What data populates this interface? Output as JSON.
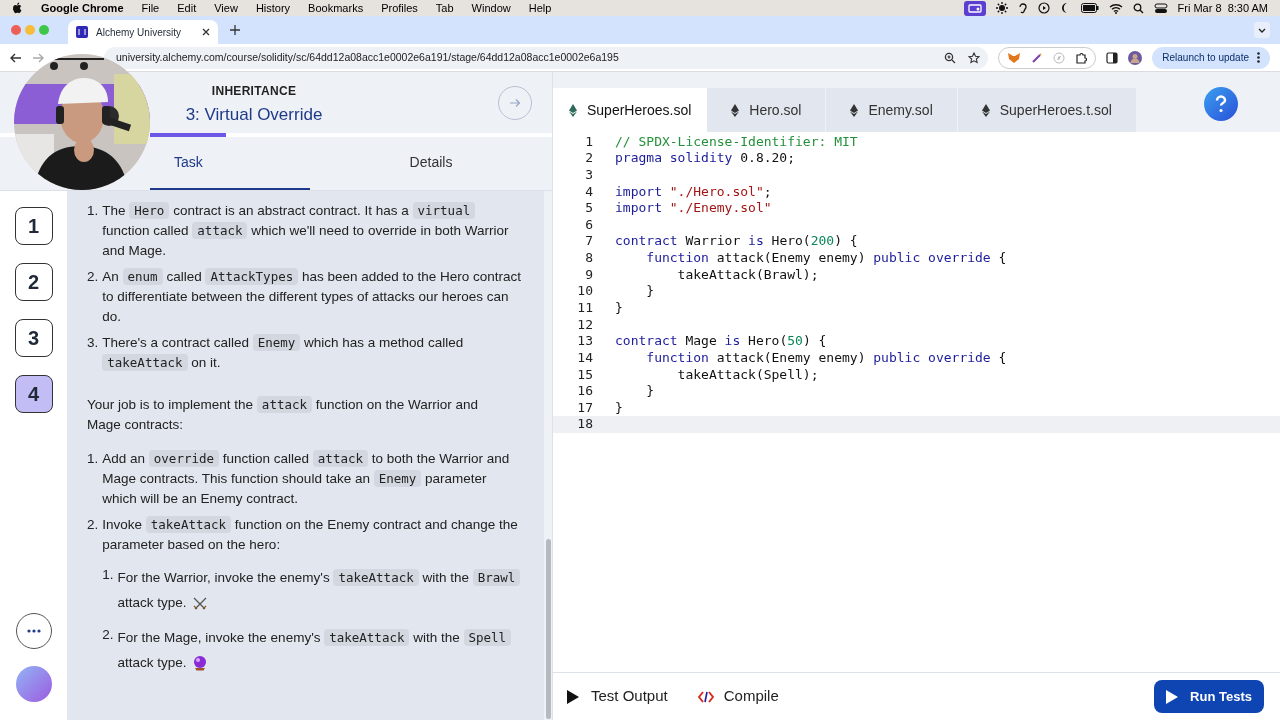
{
  "menubar": {
    "app": "Google Chrome",
    "menus": [
      "File",
      "Edit",
      "View",
      "History",
      "Bookmarks",
      "Profiles",
      "Tab",
      "Window",
      "Help"
    ],
    "clock": "Fri Mar 8  8:30 AM"
  },
  "browser": {
    "tab_title": "Alchemy University",
    "url": "university.alchemy.com/course/solidity/sc/64dd12a08acc1e0002e6a191/stage/64dd12a08acc1e0002e6a195",
    "relaunch": "Relaunch to update"
  },
  "lesson": {
    "section": "INHERITANCE",
    "title": "3: Virtual Override",
    "progress": {
      "level": 0.19
    },
    "tabs": [
      {
        "label": "Task",
        "selected": true
      },
      {
        "label": "Details",
        "selected": false
      }
    ]
  },
  "stages": [
    {
      "label": "1",
      "selected": false
    },
    {
      "label": "2",
      "selected": false
    },
    {
      "label": "3",
      "selected": false
    },
    {
      "label": "4",
      "selected": true
    }
  ],
  "task": [
    {
      "kind": "list",
      "items": [
        {
          "number": "1.",
          "parts": [
            {
              "kind": "text",
              "text": "The "
            },
            {
              "kind": "code",
              "text": "Hero"
            },
            {
              "kind": "text",
              "text": " contract is an abstract contract. It has a "
            },
            {
              "kind": "code",
              "text": "virtual"
            },
            {
              "kind": "text",
              "text": " function called "
            },
            {
              "kind": "code",
              "text": "attack"
            },
            {
              "kind": "text",
              "text": " which we'll need to override in both Warrior and Mage."
            }
          ]
        },
        {
          "number": "2.",
          "parts": [
            {
              "kind": "text",
              "text": "An "
            },
            {
              "kind": "code",
              "text": "enum"
            },
            {
              "kind": "text",
              "text": " called "
            },
            {
              "kind": "code",
              "text": "AttackTypes"
            },
            {
              "kind": "text",
              "text": " has been added to the Hero contract to differentiate between the different types of attacks our heroes can do."
            }
          ]
        },
        {
          "number": "3.",
          "parts": [
            {
              "kind": "text",
              "text": "There's a contract called "
            },
            {
              "kind": "code",
              "text": "Enemy"
            },
            {
              "kind": "text",
              "text": " which has a method called "
            },
            {
              "kind": "code",
              "text": "takeAttack"
            },
            {
              "kind": "text",
              "text": " on it."
            }
          ]
        }
      ]
    },
    {
      "kind": "paragraph",
      "parts": [
        {
          "kind": "text",
          "text": "Your job is to implement the "
        },
        {
          "kind": "code",
          "text": "attack"
        },
        {
          "kind": "text",
          "text": " function on the Warrior and Mage contracts:"
        }
      ]
    },
    {
      "kind": "list",
      "items": [
        {
          "number": "1.",
          "parts": [
            {
              "kind": "text",
              "text": "Add an "
            },
            {
              "kind": "code",
              "text": "override"
            },
            {
              "kind": "text",
              "text": " function called "
            },
            {
              "kind": "code",
              "text": "attack"
            },
            {
              "kind": "text",
              "text": " to both the Warrior and Mage contracts. This function should take an "
            },
            {
              "kind": "code",
              "text": "Enemy"
            },
            {
              "kind": "text",
              "text": " parameter which will be an Enemy contract."
            }
          ]
        },
        {
          "number": "2.",
          "parts": [
            {
              "kind": "text",
              "text": "Invoke "
            },
            {
              "kind": "code",
              "text": "takeAttack"
            },
            {
              "kind": "text",
              "text": " function on the Enemy contract and change the parameter based on the hero:"
            }
          ],
          "children": [
            {
              "number": "1.",
              "parts": [
                {
                  "kind": "text",
                  "text": "For the Warrior, invoke the enemy's "
                },
                {
                  "kind": "code",
                  "text": "takeAttack"
                },
                {
                  "kind": "text",
                  "text": " with the "
                },
                {
                  "kind": "code",
                  "text": "Brawl"
                },
                {
                  "kind": "text",
                  "text": " attack type."
                }
              ]
            },
            {
              "number": "2.",
              "parts": [
                {
                  "kind": "text",
                  "text": "For the Mage, invoke the enemy's "
                },
                {
                  "kind": "code",
                  "text": "takeAttack"
                },
                {
                  "kind": "text",
                  "text": " with the "
                },
                {
                  "kind": "code",
                  "text": "Spell"
                },
                {
                  "kind": "text",
                  "text": " attack type."
                }
              ]
            }
          ]
        }
      ]
    }
  ],
  "editor": {
    "files": [
      {
        "label": "SuperHeroes.sol",
        "selected": true
      },
      {
        "label": "Hero.sol",
        "selected": false
      },
      {
        "label": "Enemy.sol",
        "selected": false
      },
      {
        "label": "SuperHeroes.t.sol",
        "selected": false
      }
    ],
    "lines": [
      {
        "n": "1",
        "current": false,
        "tokens": [
          {
            "kind": "comment",
            "text": "// SPDX-License-Identifier: MIT"
          }
        ]
      },
      {
        "n": "2",
        "current": false,
        "tokens": [
          {
            "kind": "keyword",
            "text": "pragma solidity"
          },
          {
            "kind": "plain",
            "text": " 0.8.20;"
          }
        ]
      },
      {
        "n": "3",
        "current": false
      },
      {
        "n": "4",
        "current": false,
        "tokens": [
          {
            "kind": "keyword",
            "text": "import"
          },
          {
            "kind": "string",
            "text": " \"./Hero.sol\""
          },
          {
            "kind": "plain",
            "text": ";"
          }
        ]
      },
      {
        "n": "5",
        "current": false,
        "tokens": [
          {
            "kind": "keyword",
            "text": "import"
          },
          {
            "kind": "string",
            "text": " \"./Enemy.sol\""
          }
        ]
      },
      {
        "n": "6",
        "current": false
      },
      {
        "n": "7",
        "current": false,
        "tokens": [
          {
            "kind": "keyword",
            "text": "contract"
          },
          {
            "kind": "plain",
            "text": " Warrior "
          },
          {
            "kind": "keyword",
            "text": "is"
          },
          {
            "kind": "plain",
            "text": " Hero("
          },
          {
            "kind": "number",
            "text": "200"
          },
          {
            "kind": "plain",
            "text": ") {"
          }
        ]
      },
      {
        "n": "8",
        "current": false,
        "tokens": [
          {
            "kind": "keyword",
            "text": "    function"
          },
          {
            "kind": "plain",
            "text": " attack(Enemy enemy) "
          },
          {
            "kind": "keyword",
            "text": "public override"
          },
          {
            "kind": "plain",
            "text": " {"
          }
        ]
      },
      {
        "n": "9",
        "current": false,
        "tokens": [
          {
            "kind": "plain",
            "text": "        takeAttack(Brawl);"
          }
        ]
      },
      {
        "n": "10",
        "current": false,
        "tokens": [
          {
            "kind": "plain",
            "text": "    }"
          }
        ]
      },
      {
        "n": "11",
        "current": false,
        "tokens": [
          {
            "kind": "plain",
            "text": "}"
          }
        ]
      },
      {
        "n": "12",
        "current": false
      },
      {
        "n": "13",
        "current": false,
        "tokens": [
          {
            "kind": "keyword",
            "text": "contract"
          },
          {
            "kind": "plain",
            "text": " Mage "
          },
          {
            "kind": "keyword",
            "text": "is"
          },
          {
            "kind": "plain",
            "text": " Hero("
          },
          {
            "kind": "number",
            "text": "50"
          },
          {
            "kind": "plain",
            "text": ") {"
          }
        ]
      },
      {
        "n": "14",
        "current": false,
        "tokens": [
          {
            "kind": "keyword",
            "text": "    function"
          },
          {
            "kind": "plain",
            "text": " attack(Enemy enemy) "
          },
          {
            "kind": "keyword",
            "text": "public override"
          },
          {
            "kind": "plain",
            "text": " {"
          }
        ]
      },
      {
        "n": "15",
        "current": false,
        "tokens": [
          {
            "kind": "plain",
            "text": "        takeAttack(Spell);"
          }
        ]
      },
      {
        "n": "16",
        "current": false,
        "tokens": [
          {
            "kind": "plain",
            "text": "    }"
          }
        ]
      },
      {
        "n": "17",
        "current": false,
        "tokens": [
          {
            "kind": "plain",
            "text": "}"
          }
        ]
      },
      {
        "n": "18",
        "current": true
      }
    ]
  },
  "bottom": {
    "test_output": "Test Output",
    "compile": "Compile",
    "run": "Run Tests"
  }
}
